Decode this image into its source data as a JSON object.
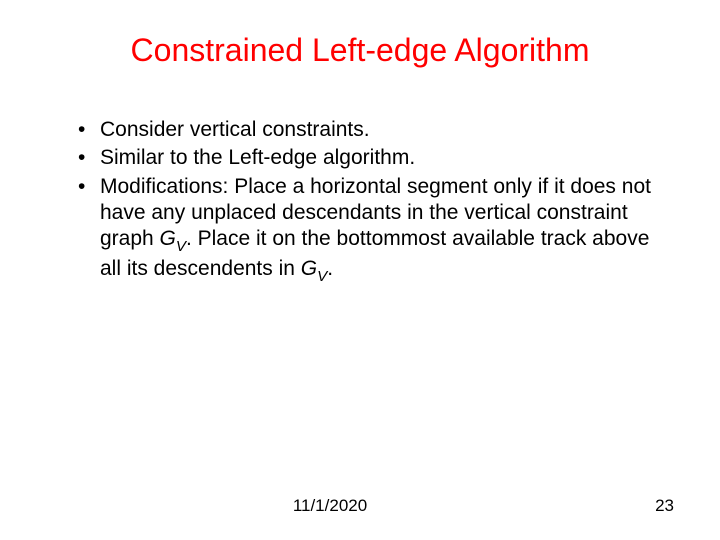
{
  "title": "Constrained Left-edge Algorithm",
  "bullets": {
    "b1": "Consider vertical constraints.",
    "b2": "Similar to the Left-edge algorithm.",
    "b3_part1": "Modifications: Place a horizontal segment only if it does not have any unplaced descendants in the vertical constraint graph ",
    "b3_gv_g": "G",
    "b3_gv_v": "V",
    "b3_part2": ". Place it on the bottommost available track above all its descendents in ",
    "b3_gv2_g": "G",
    "b3_gv2_v": "V",
    "b3_part3": "."
  },
  "footer": {
    "date": "11/1/2020",
    "page": "23"
  }
}
